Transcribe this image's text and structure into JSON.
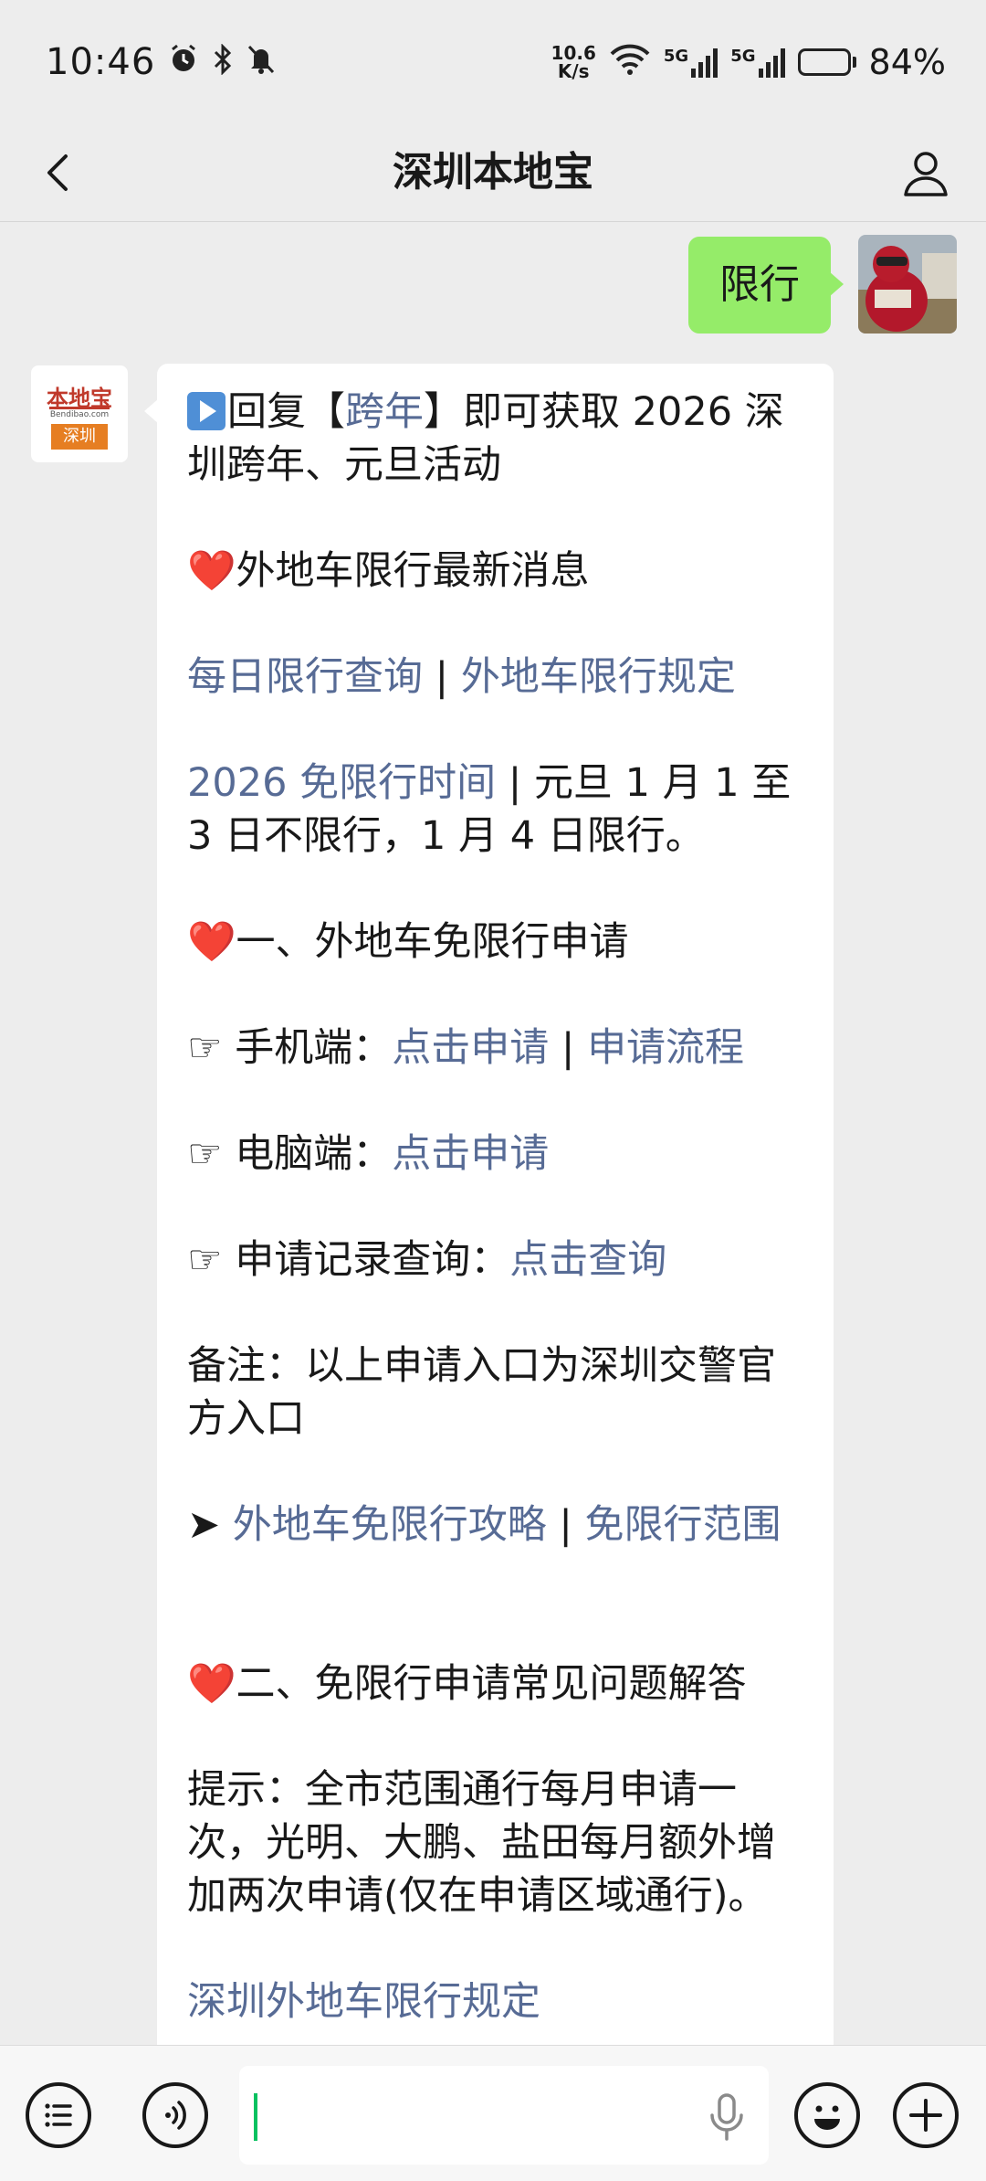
{
  "status_bar": {
    "time": "10:46",
    "net_speed_value": "10.6",
    "net_speed_unit": "K/s",
    "sim1": "5G",
    "sim2": "5G",
    "battery_percent": "84%",
    "battery_level": 0.84
  },
  "header": {
    "title": "深圳本地宝"
  },
  "chat": {
    "outgoing_message": "限行",
    "bot_avatar": {
      "logo_text": "本地宝",
      "logo_url": "Bendibao.com",
      "logo_city": "深圳"
    },
    "reply": {
      "p1_a": "回复【",
      "p1_link": "跨年",
      "p1_b": "】即可获取 2026 深圳跨年、元旦活动",
      "heart1": "❤️",
      "h1": "外地车限行最新消息",
      "l1_a": "每日限行查询",
      "sep": " | ",
      "l1_b": "外地车限行规定",
      "l2_link": "2026 免限行时间",
      "l2_text": "元旦 1 月 1 至 3 日不限行，1 月 4 日限行。",
      "heart2": "❤️",
      "h2": "一、外地车免限行申请",
      "hand": "☞",
      "mobile_label": "手机端：",
      "mobile_link1": "点击申请",
      "mobile_link2": "申请流程",
      "pc_label": "电脑端：",
      "pc_link": "点击申请",
      "record_label": "申请记录查询：",
      "record_link": "点击查询",
      "note": "备注：以上申请入口为深圳交警官方入口",
      "arrow": "➤",
      "guide_link": "外地车免限行攻略",
      "range_link": "免限行范围",
      "heart3": "❤️",
      "h3": "二、免限行申请常见问题解答",
      "tip": "提示：全市范围通行每月申请一次，光明、大鹏、盐田每月额外增加两次申请(仅在申请区域通行)。",
      "last_link": "深圳外地车限行规定"
    }
  },
  "colors": {
    "link": "#576b95",
    "outgoing_bubble": "#95ec69",
    "background": "#ededed"
  }
}
